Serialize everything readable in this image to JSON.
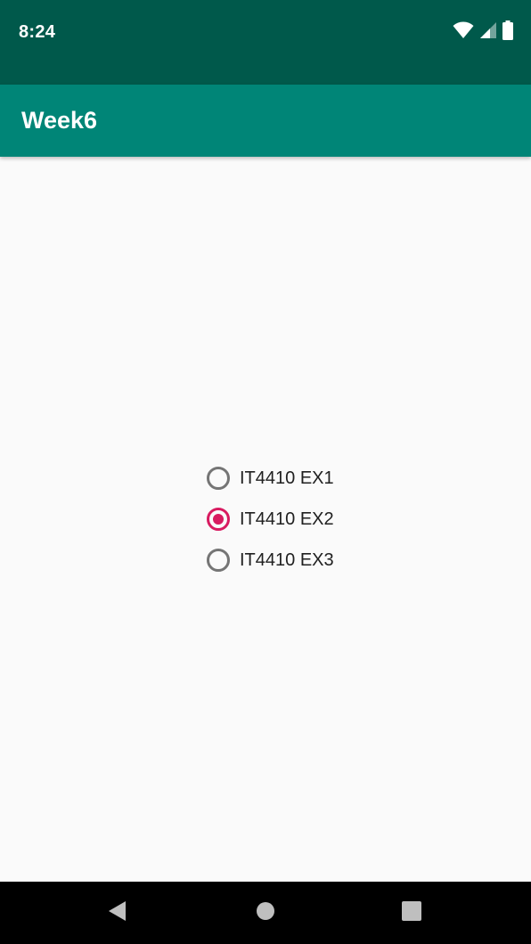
{
  "status_bar": {
    "time": "8:24",
    "icons": [
      "wifi-icon",
      "cellular-signal-icon",
      "battery-icon"
    ]
  },
  "app_bar": {
    "title": "Week6"
  },
  "radio_group": {
    "options": [
      {
        "label": "IT4410 EX1",
        "checked": false
      },
      {
        "label": "IT4410 EX2",
        "checked": true
      },
      {
        "label": "IT4410 EX3",
        "checked": false
      }
    ]
  },
  "nav_bar": {
    "buttons": [
      "back-icon",
      "home-icon",
      "recents-icon"
    ]
  },
  "colors": {
    "status_bar": "#00594b",
    "app_bar": "#008577",
    "accent": "#d81b60",
    "background": "#fafafa",
    "radio_unchecked": "#757575"
  }
}
